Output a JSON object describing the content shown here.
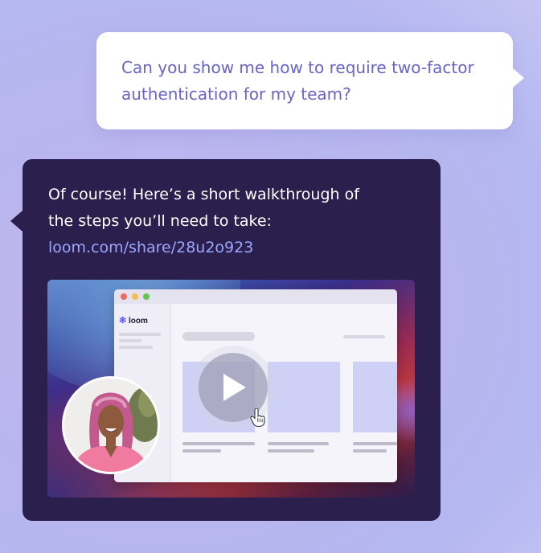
{
  "user_message": {
    "line1": "Can you show me how to require two-factor",
    "line2": "authentication for my team?"
  },
  "assistant_message": {
    "line1": "Of course! Here’s a short walkthrough of",
    "line2": "the steps you’ll need to take:",
    "link": "loom.com/share/28u2o923"
  },
  "video_preview": {
    "app_logo": "loom",
    "play_icon": "play-icon",
    "cursor_icon": "hand-pointer-icon"
  },
  "colors": {
    "user_text": "#6a64c6",
    "assistant_bg": "#2b1f4e",
    "link": "#9da6ff",
    "tile": "#cfd0f5"
  }
}
